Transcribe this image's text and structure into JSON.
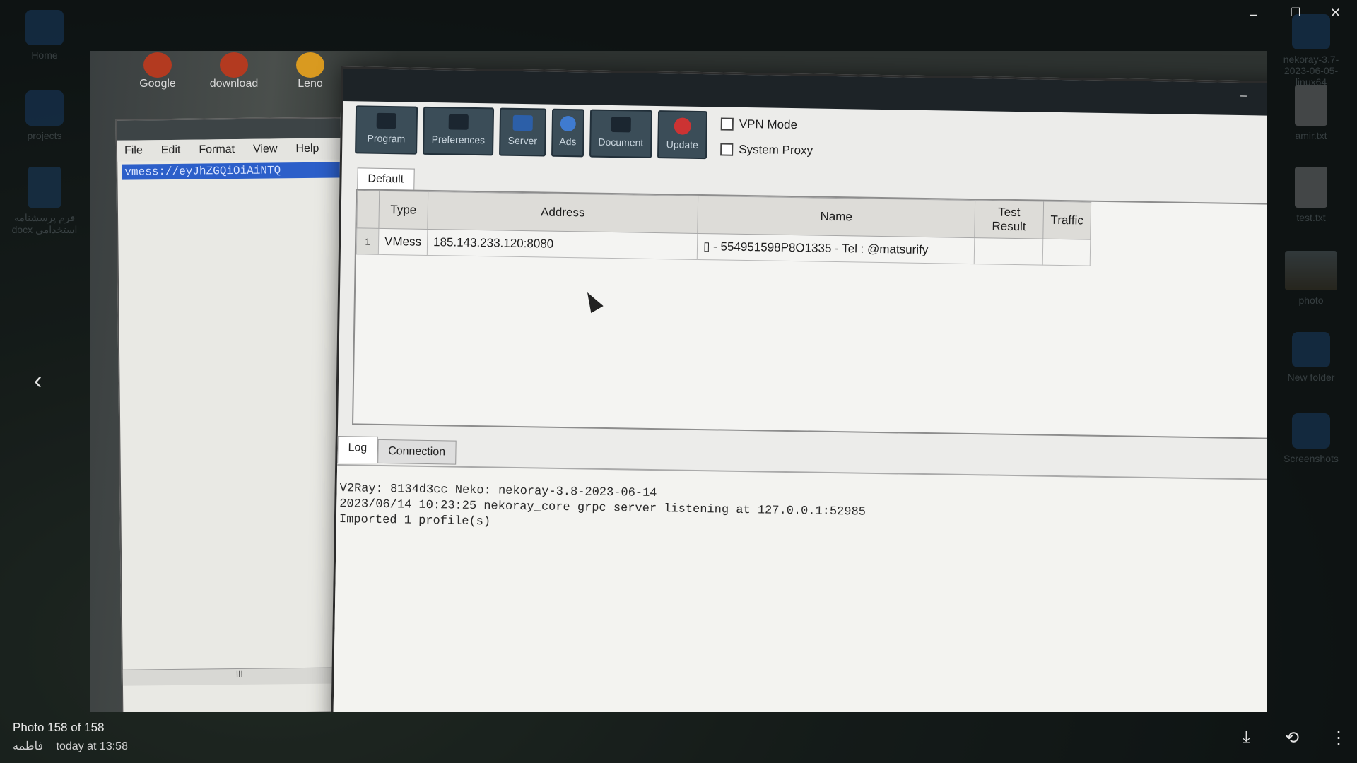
{
  "desktop": {
    "left_icons": [
      "Home",
      "projects",
      "فرم پرسشنامه docx استخدامی"
    ],
    "right_icons": [
      "nekoray-3.7-2023-06-05-linux64",
      "amir.txt",
      "test.txt",
      "photo",
      "New folder",
      "Screenshots"
    ]
  },
  "viewer": {
    "counter": "Photo 158 of 158",
    "author": "فاطمه",
    "date": "today at 13:58"
  },
  "notepad": {
    "menu": [
      "File",
      "Edit",
      "Format",
      "View",
      "Help"
    ],
    "selected_text": "vmess://eyJhZGQiOiAiNTQ",
    "scroll_label": "III"
  },
  "taskbar_icons": [
    "Google",
    "download",
    "Leno"
  ],
  "nekoray": {
    "toolbar": [
      "Program",
      "Preferences",
      "Server",
      "Ads",
      "Document",
      "Update"
    ],
    "vpn_mode": "VPN Mode",
    "system_proxy": "System Proxy",
    "group_tab": "Default",
    "columns": [
      "Type",
      "Address",
      "Name",
      "Test Result",
      "Traffic"
    ],
    "rows": [
      {
        "num": "1",
        "type": "VMess",
        "address": "185.143.233.120:8080",
        "name": "▯ - 554951598P8O1335 - Tel : @matsurify",
        "test": "",
        "traffic": ""
      }
    ],
    "log_tabs": [
      "Log",
      "Connection"
    ],
    "log_lines": [
      "V2Ray: 8134d3cc Neko: nekoray-3.8-2023-06-14",
      "2023/06/14 10:23:25 nekoray_core grpc server listening at 127.0.0.1:52985",
      "Imported 1 profile(s)"
    ]
  }
}
